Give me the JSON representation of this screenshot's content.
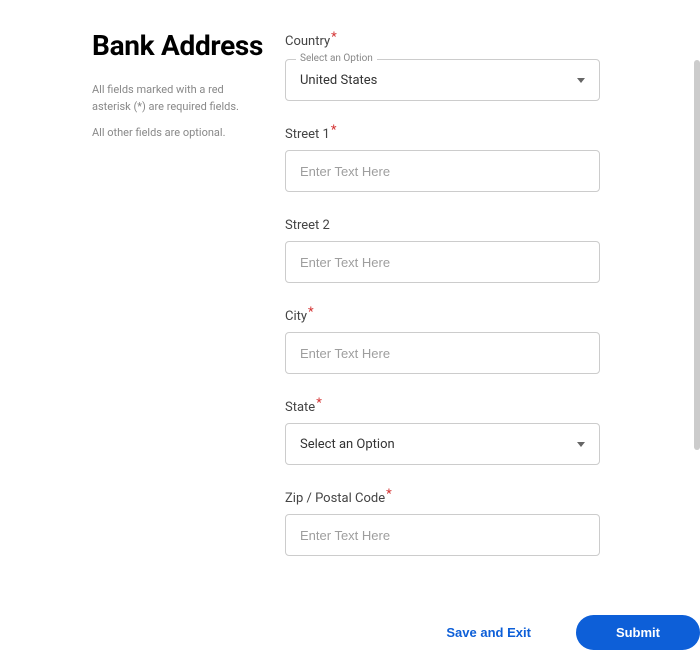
{
  "sidebar": {
    "title": "Bank Address",
    "helper1": "All fields marked with a red asterisk (*) are required fields.",
    "helper2": "All other fields are optional."
  },
  "form": {
    "country": {
      "label": "Country",
      "required": "*",
      "floating_label": "Select an Option",
      "value": "United States"
    },
    "street1": {
      "label": "Street 1",
      "required": "*",
      "placeholder": "Enter Text Here"
    },
    "street2": {
      "label": "Street 2",
      "placeholder": "Enter Text Here"
    },
    "city": {
      "label": "City",
      "required": "*",
      "placeholder": "Enter Text Here"
    },
    "state": {
      "label": "State",
      "required": "*",
      "placeholder": "Select an Option"
    },
    "zip": {
      "label": "Zip / Postal Code",
      "required": "*",
      "placeholder": "Enter Text Here"
    }
  },
  "footer": {
    "save_exit": "Save and Exit",
    "submit": "Submit"
  }
}
